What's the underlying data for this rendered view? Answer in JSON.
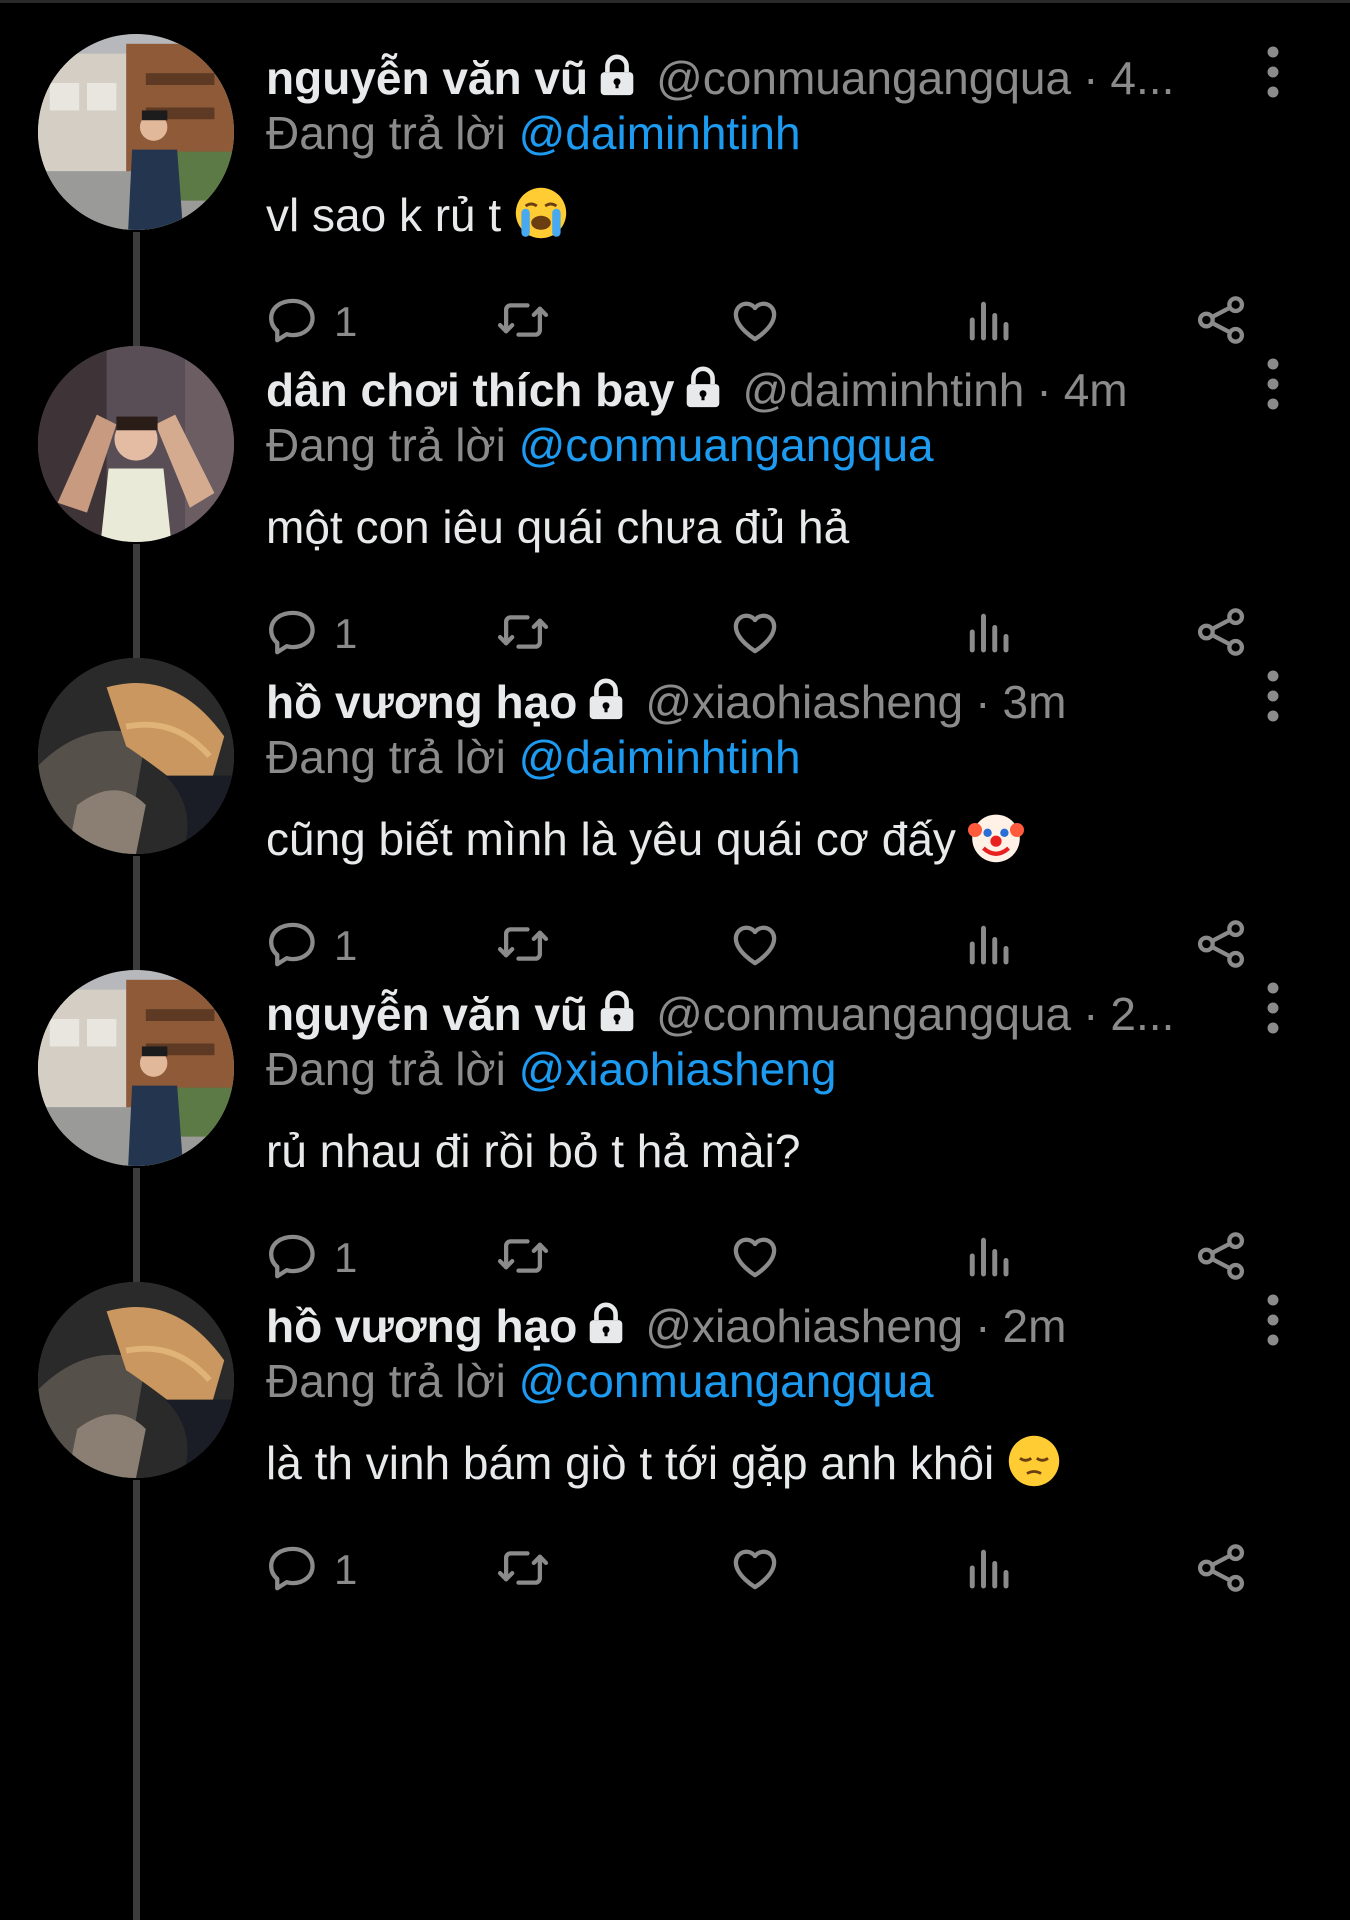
{
  "tweets": [
    {
      "display_name": "nguyễn văn vũ",
      "handle": "@conmuangangqua",
      "dot": "·",
      "time": "4...",
      "replying_prefix": "Đang trả lời ",
      "replying_to": "@daiminhtinh",
      "text": "vl sao k rủ t",
      "emoji": "loudly-crying-face-emoji",
      "reply_count": "1",
      "avatar": "street-avatar"
    },
    {
      "display_name": "dân chơi thích bay",
      "handle": "@daiminhtinh",
      "dot": "·",
      "time": "4m",
      "replying_prefix": "Đang trả lời ",
      "replying_to": "@conmuangangqua",
      "text": "một con iêu quái chưa đủ hả",
      "emoji": "",
      "reply_count": "1",
      "avatar": "party-avatar"
    },
    {
      "display_name": "hồ vương hạo",
      "handle": "@xiaohiasheng",
      "dot": "·",
      "time": "3m",
      "replying_prefix": "Đang trả lời ",
      "replying_to": "@daiminhtinh",
      "text": "cũng biết mình là yêu quái cơ đấy",
      "emoji": "clown-face-emoji",
      "reply_count": "1",
      "avatar": "blond-hair-avatar"
    },
    {
      "display_name": "nguyễn văn vũ",
      "handle": "@conmuangangqua",
      "dot": "·",
      "time": "2...",
      "replying_prefix": "Đang trả lời ",
      "replying_to": "@xiaohiasheng",
      "text": "rủ nhau đi rồi bỏ t hả mài?",
      "emoji": "",
      "reply_count": "1",
      "avatar": "street-avatar"
    },
    {
      "display_name": "hồ vương hạo",
      "handle": "@xiaohiasheng",
      "dot": "·",
      "time": "2m",
      "replying_prefix": "Đang trả lời ",
      "replying_to": "@conmuangangqua",
      "text": "là th vinh bám giò t tới gặp anh khôi",
      "emoji": "pensive-face-emoji",
      "reply_count": "1",
      "avatar": "blond-hair-avatar"
    }
  ],
  "colors": {
    "background": "#000000",
    "primary_text": "#e7e9ea",
    "secondary_text": "#8b8b8b",
    "link": "#1d9bf0",
    "thread_line": "#3c3c3c"
  },
  "icons": [
    "lock-icon",
    "more-vertical-icon",
    "reply-icon",
    "retweet-icon",
    "like-icon",
    "views-icon",
    "share-icon"
  ]
}
